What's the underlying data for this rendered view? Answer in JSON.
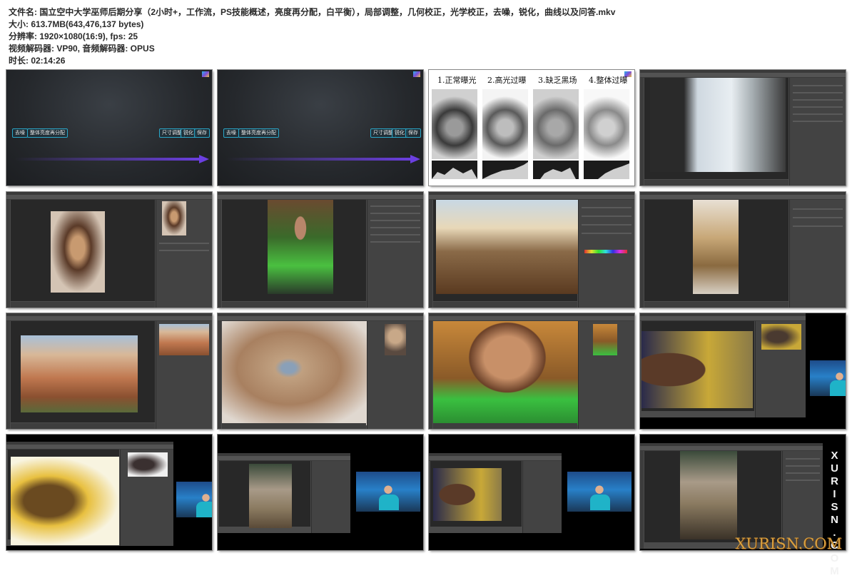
{
  "file_info": {
    "filename": "文件名: 国立空中大学巫师后期分享（2小时+，工作流，PS技能概述，亮度再分配，白平衡），局部调整，几何校正，光学校正，去噪，锐化，曲线以及问答.mkv",
    "size": "大小: 613.7MB(643,476,137 bytes)",
    "resolution": "分辨率: 1920×1080(16:9), fps: 25",
    "codecs": "视频解码器: VP90, 音频解码器: OPUS",
    "duration": "时长: 02:14:26"
  },
  "slide": {
    "left_buttons": [
      "去噪",
      "整体亮度再分配"
    ],
    "right_buttons": [
      "尺寸调整",
      "锐化",
      "保存"
    ],
    "arrow_color": "#6b3fe0",
    "button_border_color": "#2aa7c9"
  },
  "exposure_panel": {
    "titles": [
      "1.正常曝光",
      "2.高光过曝",
      "3.缺乏黑场",
      "4.整体过曝"
    ]
  },
  "watermark": {
    "side": "XURISN.COM",
    "corner": "XURISN.COM"
  },
  "colors": {
    "ps_background": "#4b4b4b",
    "ps_canvas": "#282828",
    "ps_panel": "#434343"
  }
}
